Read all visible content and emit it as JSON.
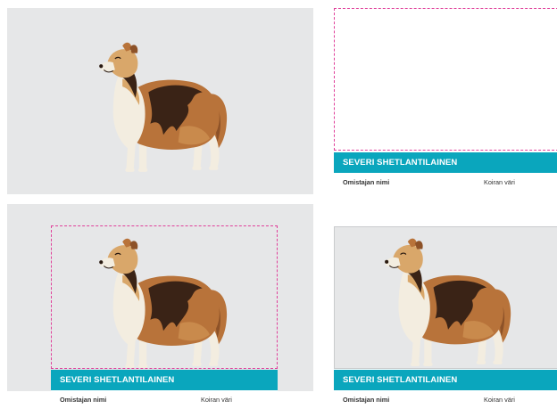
{
  "colors": {
    "panel_bg": "#e6e7e8",
    "label_bar": "#0aa6bd",
    "dash_frame": "#e0409a",
    "dog_brown": "#b8733a",
    "dog_dark": "#3a2316",
    "dog_cream": "#f3ede0",
    "dog_tan": "#d9a76a"
  },
  "icons": {
    "dog_illustration": "shetland-sheepdog-illustration"
  },
  "cards": [
    {
      "id": "top-left",
      "label": null
    },
    {
      "id": "top-right",
      "label": {
        "title": "SEVERI SHETLANTILAINEN",
        "owner_field": "Omistajan nimi",
        "color_field": "Koiran väri"
      }
    },
    {
      "id": "bottom-left",
      "label": {
        "title": "SEVERI SHETLANTILAINEN",
        "owner_field": "Omistajan nimi",
        "color_field": "Koiran väri"
      }
    },
    {
      "id": "bottom-right",
      "label": {
        "title": "SEVERI SHETLANTILAINEN",
        "owner_field": "Omistajan nimi",
        "color_field": "Koiran väri"
      }
    }
  ]
}
